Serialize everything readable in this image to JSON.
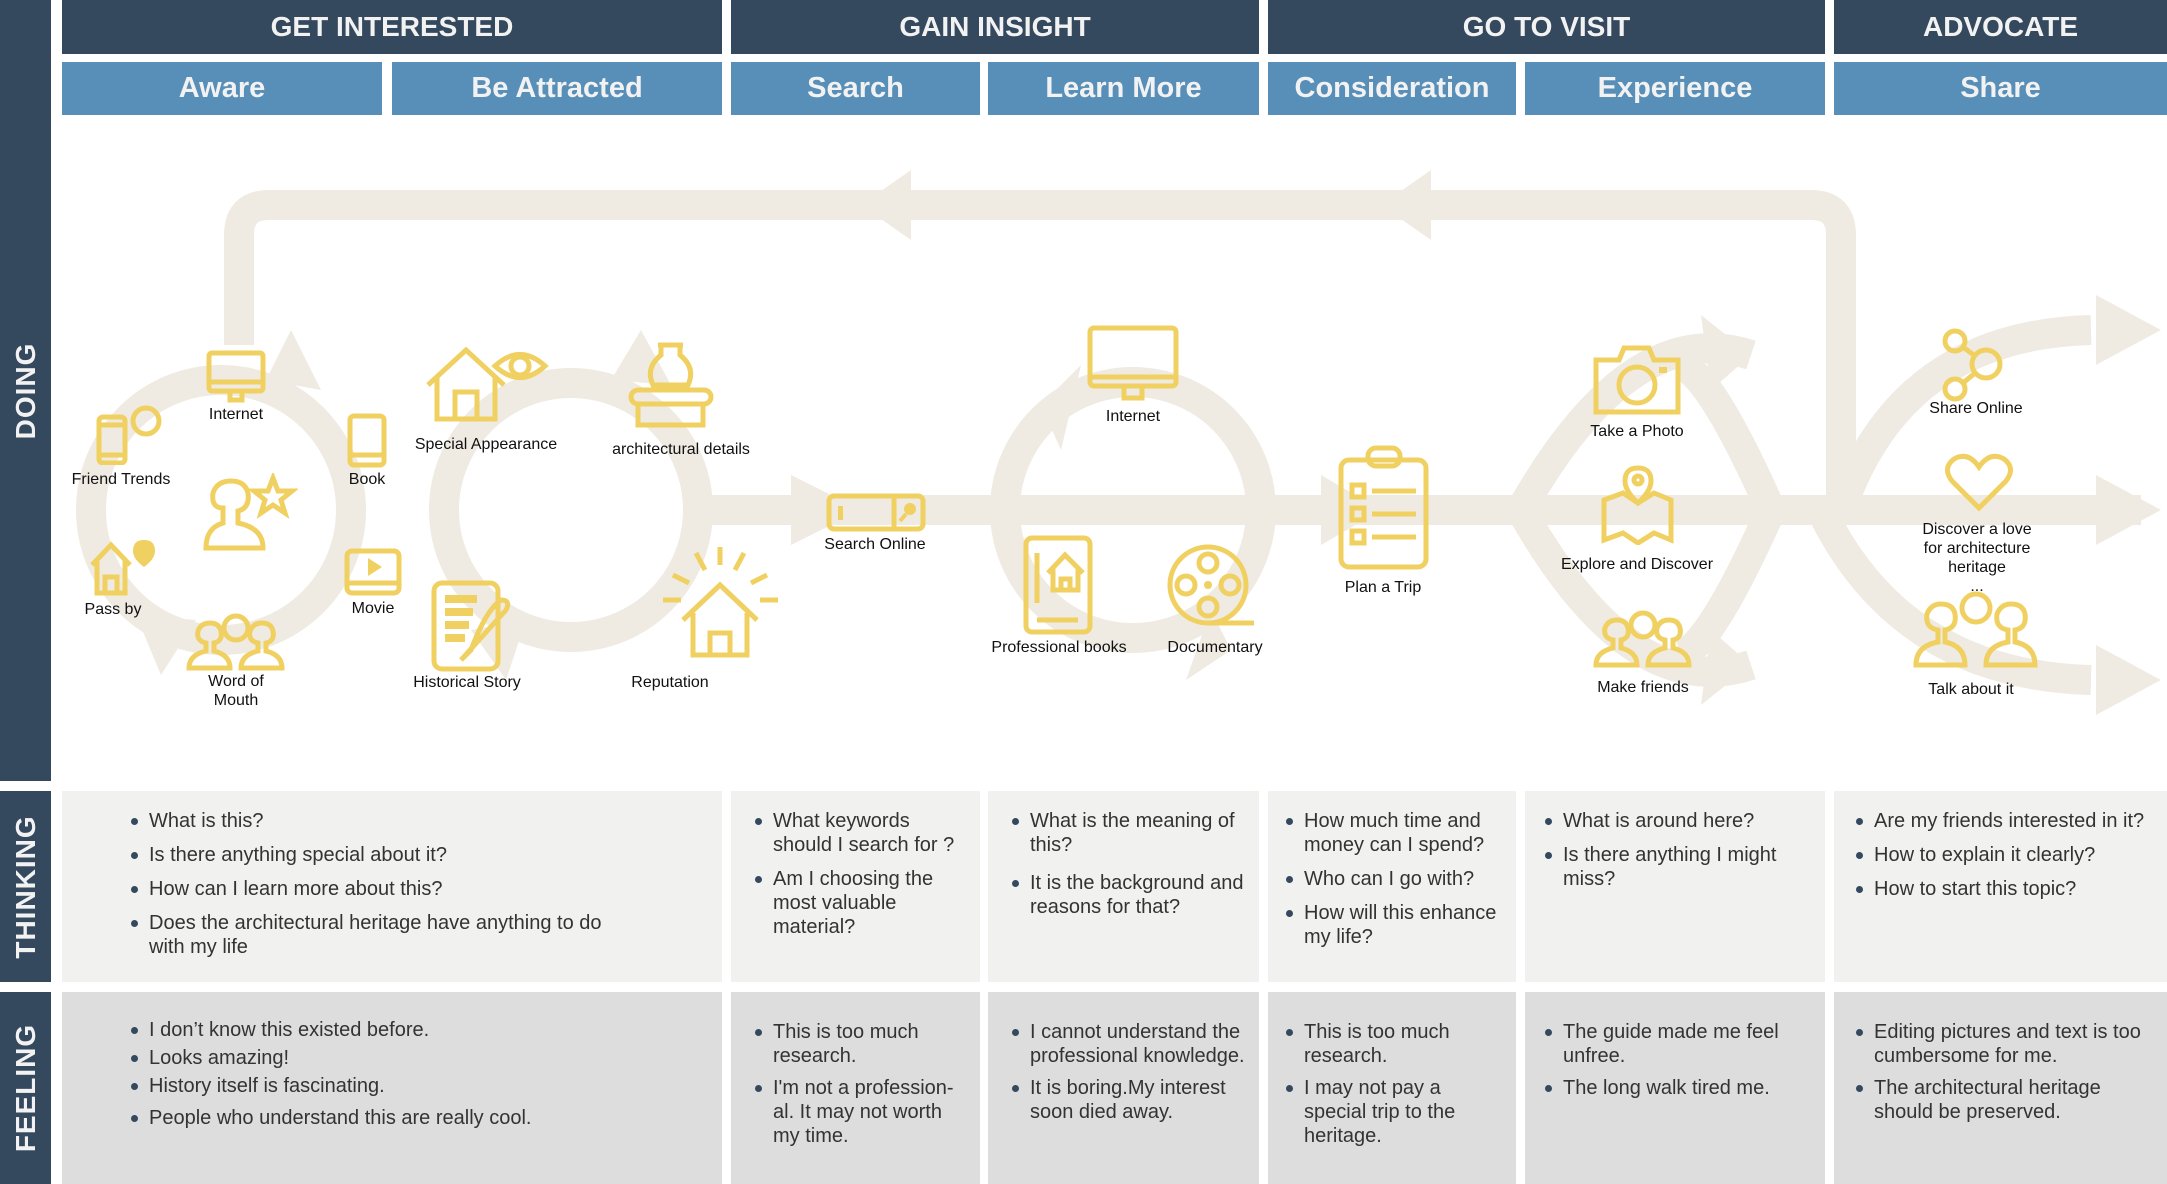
{
  "stages": [
    {
      "label": "GET INTERESTED"
    },
    {
      "label": "GAIN INSIGHT"
    },
    {
      "label": "GO TO VISIT"
    },
    {
      "label": "ADVOCATE"
    }
  ],
  "steps": [
    {
      "label": "Aware"
    },
    {
      "label": "Be Attracted"
    },
    {
      "label": "Search"
    },
    {
      "label": "Learn More"
    },
    {
      "label": "Consideration"
    },
    {
      "label": "Experience"
    },
    {
      "label": "Share"
    }
  ],
  "row_labels": {
    "doing": "DOING",
    "thinking": "THINKING",
    "feeling": "FEELING"
  },
  "colors": {
    "stage": "#34485e",
    "step": "#578fb8",
    "icon": "#f0d060",
    "flow": "#efebe2",
    "thinking_bg": "#f1f1f0",
    "feeling_bg": "#dcdddc"
  },
  "doing": {
    "aware": [
      {
        "label": "Internet",
        "icon": "monitor-icon"
      },
      {
        "label": "Friend Trends",
        "icon": "phone-chat-icon"
      },
      {
        "label": "Book",
        "icon": "ebook-icon"
      },
      {
        "label": "",
        "icon": "person-star-icon"
      },
      {
        "label": "Pass by",
        "icon": "house-pin-icon"
      },
      {
        "label": "Movie",
        "icon": "video-player-icon"
      },
      {
        "label": "Word of\nMouth",
        "icon": "people-chat-icon"
      }
    ],
    "be_attracted": [
      {
        "label": "Special Appearance",
        "icon": "house-eye-icon"
      },
      {
        "label": "architectural details",
        "icon": "column-vase-icon"
      },
      {
        "label": "Historical Story",
        "icon": "document-quill-icon"
      },
      {
        "label": "Reputation",
        "icon": "house-shine-icon"
      }
    ],
    "search": [
      {
        "label": "Search Online",
        "icon": "search-bar-icon"
      }
    ],
    "learn_more": [
      {
        "label": "Internet",
        "icon": "monitor-icon"
      },
      {
        "label": "Professional books",
        "icon": "book-house-icon"
      },
      {
        "label": "Documentary",
        "icon": "film-reel-icon"
      }
    ],
    "consideration": [
      {
        "label": "Plan a Trip",
        "icon": "clipboard-checklist-icon"
      }
    ],
    "experience": [
      {
        "label": "Take a Photo",
        "icon": "camera-icon"
      },
      {
        "label": "Explore and Discover",
        "icon": "map-pin-icon"
      },
      {
        "label": "Make friends",
        "icon": "people-chat-icon"
      }
    ],
    "share": [
      {
        "label": "Share Online",
        "icon": "share-icon"
      },
      {
        "label": "Discover a love\nfor architecture\nheritage\n...",
        "icon": "heart-icon"
      },
      {
        "label": "Talk about it",
        "icon": "people-chat-icon"
      }
    ]
  },
  "thinking": [
    [
      "What is this?",
      "Is there anything special about it?",
      "How can I learn more about this?",
      "Does the architectural heritage have anything to do with my life"
    ],
    [
      "What keywords should I search for ?",
      "Am I choosing the most valuable material?"
    ],
    [
      "What is the meaning of this?",
      "It is the background and reasons for that?"
    ],
    [
      "How much time and money can I spend?",
      "Who can I go with?",
      "How will this enhance my life?"
    ],
    [
      "What is around here?",
      "Is there anything I might miss?"
    ],
    [
      "Are my friends interested in it?",
      "How to explain it clearly?",
      "How to start this topic?"
    ]
  ],
  "feeling": [
    [
      "I don’t know this existed before.",
      "Looks amazing!",
      "History itself is fascinating.",
      "People who understand this are really cool."
    ],
    [
      "This is too much research.",
      "I'm not a profession-al. It may not worth my time."
    ],
    [
      "I cannot understand the professional knowledge.",
      "It is boring.My interest soon died away."
    ],
    [
      "This is too much research.",
      "I may not pay a special trip to the heritage."
    ],
    [
      "The guide made me feel unfree.",
      "The long walk tired me."
    ],
    [
      "Editing pictures and text is too  cumbersome for me.",
      "The architectural heritage should be preserved."
    ]
  ]
}
